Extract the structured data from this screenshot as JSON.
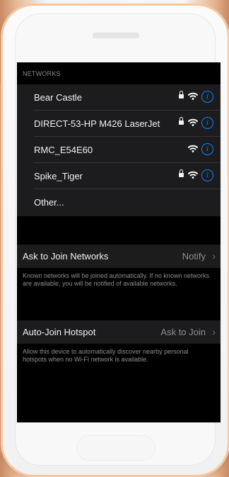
{
  "wifi": {
    "section_header": "NETWORKS",
    "networks": [
      {
        "name": "Bear Castle",
        "secured": true,
        "icon": "wifi-icon"
      },
      {
        "name": "DIRECT-53-HP M426 LaserJet",
        "secured": true,
        "icon": "wifi-icon"
      },
      {
        "name": "RMC_E54E60",
        "secured": false,
        "icon": "wifi-icon"
      },
      {
        "name": "Spike_Tiger",
        "secured": true,
        "icon": "wifi-icon"
      },
      {
        "name": "Other..."
      }
    ],
    "ask_to_join": {
      "label": "Ask to Join Networks",
      "value": "Notify",
      "description": "Known networks will be joined automatically. If no known networks are available, you will be notified of available networks."
    },
    "auto_join_hotspot": {
      "label": "Auto-Join Hotspot",
      "value": "Ask to Join",
      "description": "Allow this device to automatically discover nearby personal hotspots when no Wi-Fi network is available."
    }
  },
  "colors": {
    "screen_background": "#000000",
    "cell_background": "#1c1c1e",
    "accent": "#0a84ff",
    "secondary_text": "#8e8e93"
  }
}
